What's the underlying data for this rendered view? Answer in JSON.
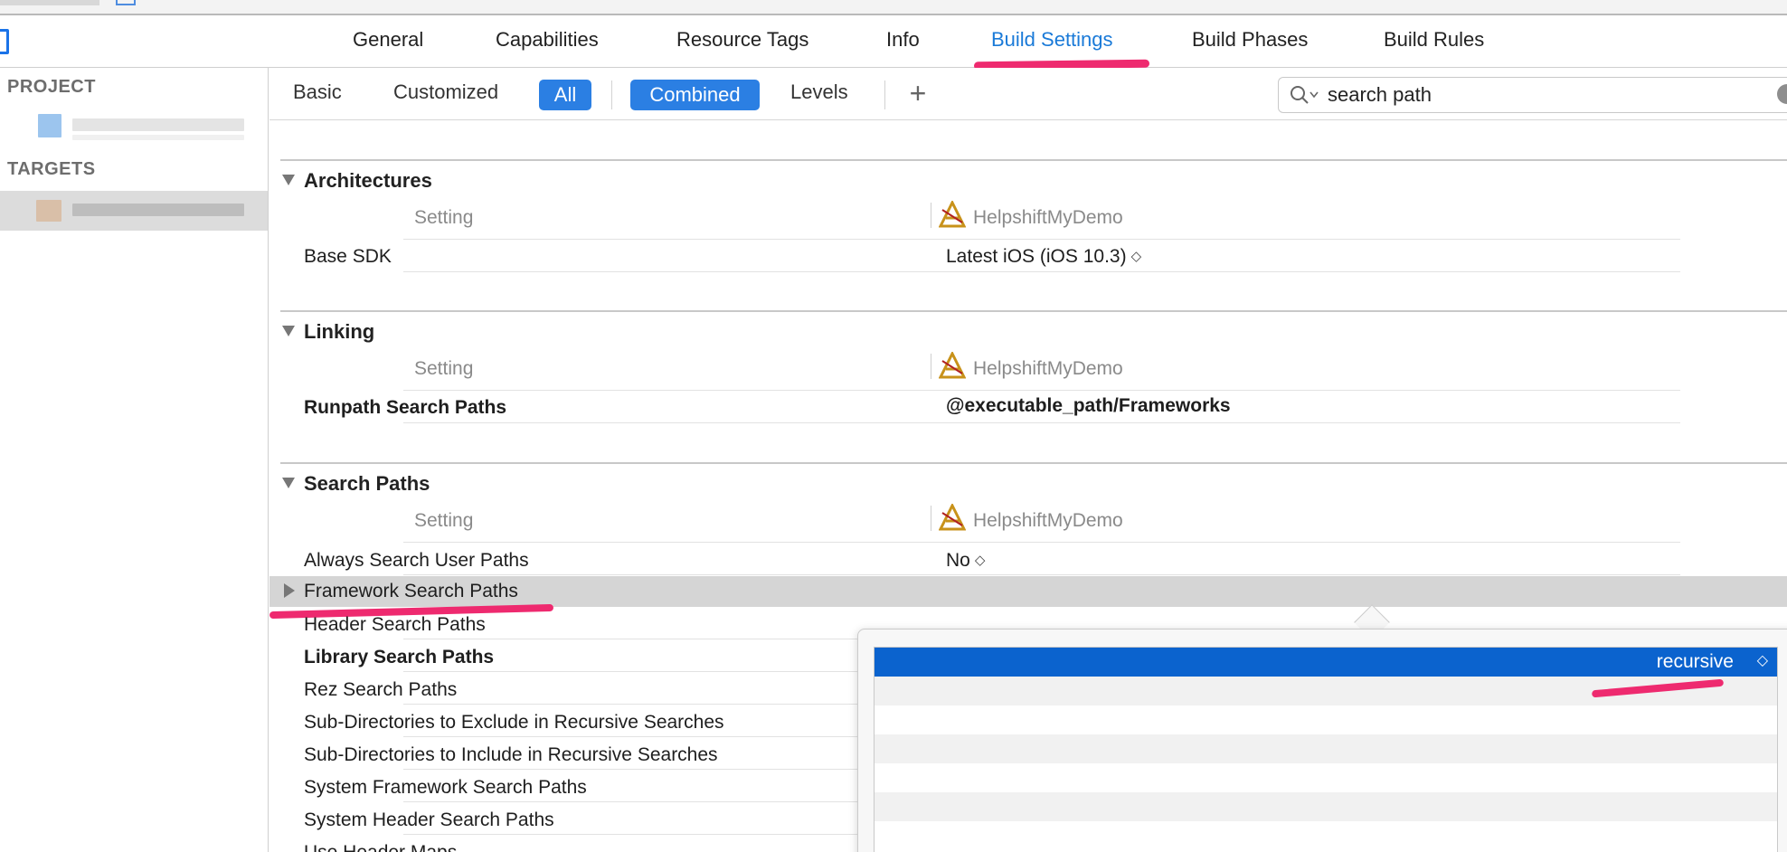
{
  "tabs": [
    {
      "label": "General"
    },
    {
      "label": "Capabilities"
    },
    {
      "label": "Resource Tags"
    },
    {
      "label": "Info"
    },
    {
      "label": "Build Settings"
    },
    {
      "label": "Build Phases"
    },
    {
      "label": "Build Rules"
    }
  ],
  "active_tab": "Build Settings",
  "sidebar": {
    "project_heading": "PROJECT",
    "targets_heading": "TARGETS"
  },
  "filters": {
    "basic": "Basic",
    "customized": "Customized",
    "all": "All",
    "combined": "Combined",
    "levels": "Levels",
    "add_glyph": "+"
  },
  "search": {
    "value": "search path"
  },
  "columns": {
    "setting": "Setting",
    "target": "HelpshiftMyDemo"
  },
  "sections": [
    {
      "title": "Architectures",
      "rows": [
        {
          "label": "Base SDK",
          "value": "Latest iOS (iOS 10.3)"
        }
      ]
    },
    {
      "title": "Linking",
      "rows": [
        {
          "label": "Runpath Search Paths",
          "value": "@executable_path/Frameworks"
        }
      ]
    },
    {
      "title": "Search Paths",
      "rows": [
        {
          "label": "Always Search User Paths",
          "value": "No"
        },
        {
          "label": "Framework Search Paths",
          "value": ""
        },
        {
          "label": "Header Search Paths",
          "value": ""
        },
        {
          "label": "Library Search Paths",
          "value": ""
        },
        {
          "label": "Rez Search Paths",
          "value": ""
        },
        {
          "label": "Sub-Directories to Exclude in Recursive Searches",
          "value": ""
        },
        {
          "label": "Sub-Directories to Include in Recursive Searches",
          "value": ""
        },
        {
          "label": "System Framework Search Paths",
          "value": ""
        },
        {
          "label": "System Header Search Paths",
          "value": ""
        },
        {
          "label": "Use Header Maps",
          "value": ""
        }
      ]
    }
  ],
  "popover": {
    "selected_value": "recursive"
  },
  "colors": {
    "accent": "#2b7fe3",
    "active_tab_text": "#1a7ad8",
    "annotation": "#ee2a6f",
    "selection": "#0b63ce"
  }
}
